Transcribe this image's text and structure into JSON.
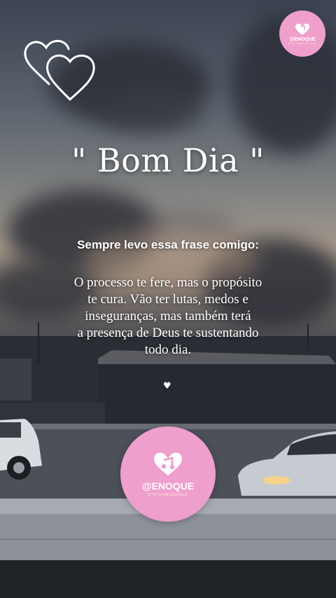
{
  "title": "\" Bom Dia \"",
  "subtitle": "Sempre levo essa frase comigo:",
  "quote_lines": [
    "O processo te fere, mas o propósito",
    "te cura. Vão ter lutas, medos e",
    "inseguranças, mas também terá",
    "a presença de Deus te sustentando",
    "todo dia."
  ],
  "watermark": {
    "name": "@ENOQUE",
    "tagline": "STATUSMUSICAIS",
    "badge_color": "#ef9fcc"
  },
  "icons": [
    "double-heart-outline-icon",
    "small-heart-icon",
    "music-heart-icon"
  ]
}
